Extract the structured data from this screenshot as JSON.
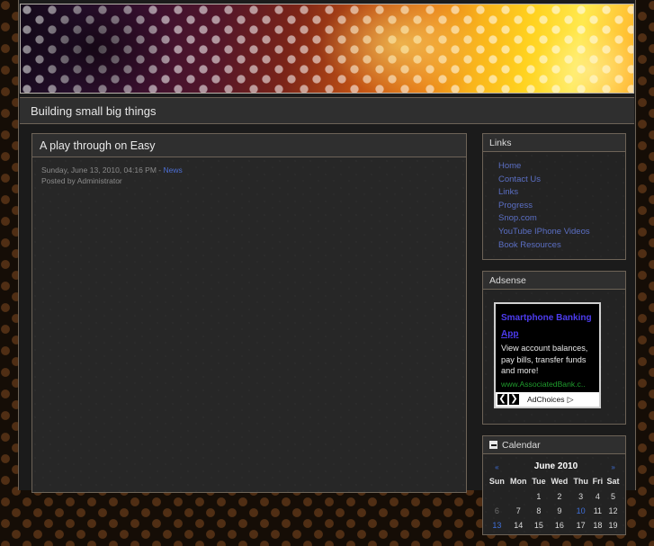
{
  "site": {
    "title": "Building small big things"
  },
  "banner": {
    "icon": "banner-photo-perforated-lights"
  },
  "post": {
    "title": "A play through on Easy",
    "date": "Sunday, June 13, 2010, 04:16 PM",
    "separator": "-",
    "category": "News",
    "posted_by": "Posted by Administrator",
    "body": ""
  },
  "sidebar": {
    "links_block": {
      "title": "Links",
      "items": [
        {
          "label": "Home"
        },
        {
          "label": "Contact Us"
        },
        {
          "label": "Links"
        },
        {
          "label": "Progress"
        },
        {
          "label": "Snop.com"
        },
        {
          "label": "YouTube IPhone Videos"
        },
        {
          "label": "Book Resources"
        }
      ]
    },
    "adsense_block": {
      "title": "Adsense",
      "ad": {
        "title_line1": "Smartphone Banking",
        "title_line2": "App",
        "text": "View account balances, pay bills, transfer funds and more!",
        "url": "www.AssociatedBank.c..",
        "prev_label": "❮",
        "next_label": "❯",
        "adchoices_label": "AdChoices",
        "adchoices_arrow": "▷"
      }
    },
    "calendar_block": {
      "title": "Calendar",
      "collapse_icon": "minus-box-icon",
      "prev_label": "«",
      "month_label": "June 2010",
      "next_label": "»",
      "weekdays": [
        "Sun",
        "Mon",
        "Tue",
        "Wed",
        "Thu",
        "Fri",
        "Sat"
      ],
      "weeks": [
        [
          {
            "label": "",
            "state": "empty"
          },
          {
            "label": "",
            "state": "empty"
          },
          {
            "label": "1",
            "state": "plain"
          },
          {
            "label": "2",
            "state": "plain"
          },
          {
            "label": "3",
            "state": "plain"
          },
          {
            "label": "4",
            "state": "plain"
          },
          {
            "label": "5",
            "state": "plain"
          }
        ],
        [
          {
            "label": "6",
            "state": "dim"
          },
          {
            "label": "7",
            "state": "plain"
          },
          {
            "label": "8",
            "state": "plain"
          },
          {
            "label": "9",
            "state": "plain"
          },
          {
            "label": "10",
            "state": "link"
          },
          {
            "label": "11",
            "state": "plain"
          },
          {
            "label": "12",
            "state": "plain"
          }
        ],
        [
          {
            "label": "13",
            "state": "link"
          },
          {
            "label": "14",
            "state": "plain"
          },
          {
            "label": "15",
            "state": "plain"
          },
          {
            "label": "16",
            "state": "plain"
          },
          {
            "label": "17",
            "state": "plain"
          },
          {
            "label": "18",
            "state": "plain"
          },
          {
            "label": "19",
            "state": "plain"
          }
        ]
      ]
    }
  },
  "colors": {
    "page_bg": "#150d06",
    "panel_bg": "#262626",
    "panel_header_bg": "#2f2f2f",
    "panel_border": "#6d6357",
    "link": "#5b6fc4",
    "ad_title": "#4d3cf0",
    "ad_url": "#1f9c2d",
    "text": "#e6e6e6"
  }
}
